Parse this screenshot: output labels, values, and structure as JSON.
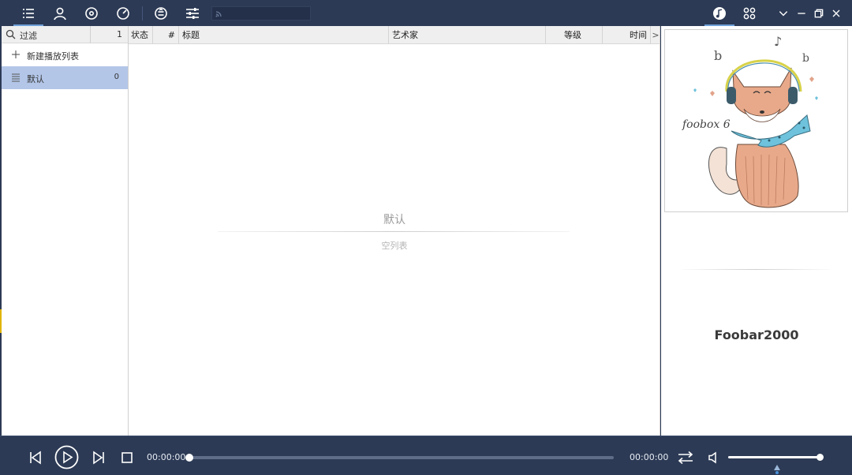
{
  "topbar": {
    "icons": [
      "playlist-menu-icon",
      "artist-icon",
      "album-icon",
      "genre-icon",
      "library-icon",
      "settings-sliders-icon",
      "rss-icon",
      "music-note-icon",
      "apps-icon",
      "chevron-down-icon",
      "minimize-icon",
      "restore-icon",
      "close-icon"
    ],
    "search_placeholder": ""
  },
  "left": {
    "filter_label": "过滤",
    "filter_count": "1",
    "new_playlist_label": "新建播放列表",
    "playlists": [
      {
        "label": "默认",
        "count": "0",
        "selected": true
      }
    ]
  },
  "playlist": {
    "columns": [
      "状态",
      "#",
      "标题",
      "艺术家",
      "等级",
      "时间"
    ],
    "more_indicator": ">",
    "empty_title": "默认",
    "empty_subtitle": "空列表"
  },
  "cover": {
    "text": "foobox 6",
    "notes": [
      "b",
      "b",
      "♪"
    ]
  },
  "nowplaying": {
    "title": "Foobar2000"
  },
  "player": {
    "elapsed": "00:00:00",
    "total": "00:00:00",
    "progress": 0,
    "volume": 1.0
  },
  "colors": {
    "bar": "#2c3a55",
    "accent": "#6fa0d8",
    "selected_row": "#b3c6e8"
  }
}
